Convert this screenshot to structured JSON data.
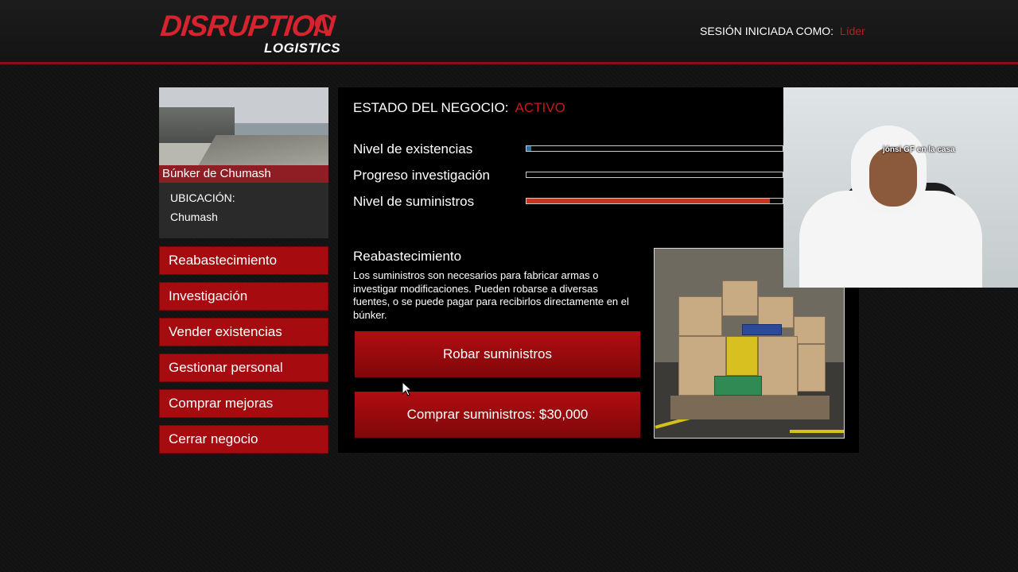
{
  "header": {
    "logo_main": "DISRUPTION",
    "logo_sub": "LOGISTICS",
    "session_label": "SESIÓN INICIADA COMO:",
    "session_value": "Líder"
  },
  "business": {
    "name": "Búnker de Chumash",
    "location_label": "UBICACIÓN:",
    "location_value": "Chumash"
  },
  "menu": {
    "items": [
      {
        "label": "Reabastecimiento"
      },
      {
        "label": "Investigación"
      },
      {
        "label": "Vender existencias"
      },
      {
        "label": "Gestionar personal"
      },
      {
        "label": "Comprar mejoras"
      },
      {
        "label": "Cerrar negocio"
      }
    ]
  },
  "status": {
    "label": "ESTADO DEL NEGOCIO:",
    "value": "ACTIVO"
  },
  "bars": [
    {
      "label": "Nivel de existencias",
      "fraction": 0.02,
      "color": "#2f6fa6"
    },
    {
      "label": "Progreso investigación",
      "fraction": 0.0,
      "color": "#2f6fa6"
    },
    {
      "label": "Nivel de suministros",
      "fraction": 0.95,
      "color": "#c23a1a"
    }
  ],
  "resupply": {
    "title": "Reabastecimiento",
    "description": "Los suministros son necesarios para fabricar armas o investigar modificaciones. Pueden robarse a diversas fuentes, o se puede pagar para recibirlos directamente en el búnker.",
    "steal_label": "Robar suministros",
    "buy_label": "Comprar suministros: $30,000"
  },
  "webcam": {
    "overlay_text": "jónsi GF en la casa"
  },
  "colors": {
    "accent": "#a50b0f",
    "status_red": "#c41a1a",
    "brand": "#d6232e"
  }
}
